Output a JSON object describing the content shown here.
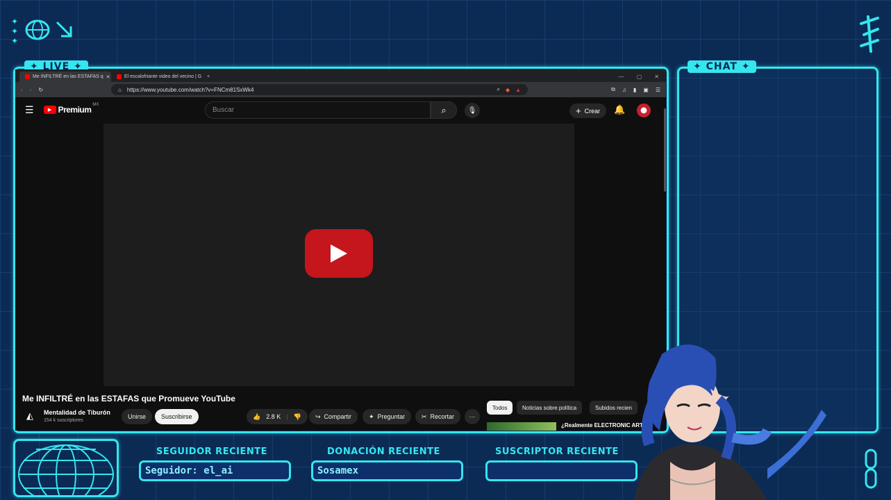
{
  "overlay": {
    "live_tag": "✦ LIVE ✦",
    "chat_tag": "✦ CHAT ✦",
    "seguidor_label": "SEGUIDOR RECIENTE",
    "seguidor_value": "Seguidor: el_ai",
    "donacion_label": "DONACIÓN RECIENTE",
    "donacion_value": "Sosamex",
    "suscriptor_label": "SUSCRIPTOR RECIENTE",
    "suscriptor_value": ""
  },
  "browser": {
    "tabs": [
      {
        "title": "Me INFILTRÉ en las ESTAFAS q"
      },
      {
        "title": "El escalofriante video del vecino | G"
      }
    ],
    "url": "https://www.youtube.com/watch?v=FNCm81SxWk4"
  },
  "youtube": {
    "brand": "Premium",
    "region": "MX",
    "search_placeholder": "Buscar",
    "create_label": "Crear",
    "video_title": "Me INFILTRÉ en las ESTAFAS que Promueve YouTube",
    "channel_name": "Mentalidad de Tiburón",
    "subscribers": "154 k suscriptores",
    "join_label": "Unirse",
    "subscribe_label": "Suscribirse",
    "likes": "2.8 K",
    "share_label": "Compartir",
    "ask_label": "Preguntar",
    "clip_label": "Recortar",
    "chips": [
      "Todos",
      "Noticias sobre política",
      "Subidos recien"
    ],
    "suggested_title": "¿Realmente ELECTRONIC ARTS"
  },
  "colors": {
    "neon": "#35e6ef",
    "background": "#0b2b55",
    "yt_red": "#ff0000"
  }
}
